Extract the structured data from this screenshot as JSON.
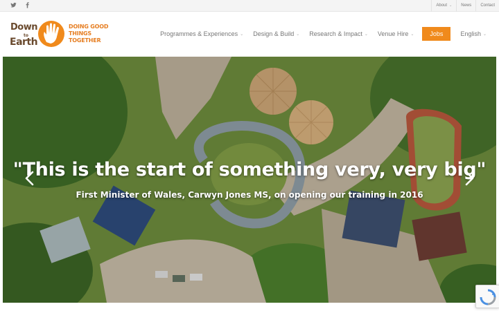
{
  "topbar": {
    "social": [
      {
        "icon": "twitter-icon",
        "glyph": "𝕏"
      },
      {
        "icon": "facebook-icon",
        "glyph": "f"
      }
    ],
    "links": [
      {
        "label": "About",
        "has_dropdown": true
      },
      {
        "label": "News",
        "has_dropdown": false
      },
      {
        "label": "Contact",
        "has_dropdown": false
      }
    ]
  },
  "logo": {
    "line1": "Down",
    "line2": "to",
    "line3": "Earth",
    "tagline": [
      "DOING GOOD",
      "THINGS",
      "TOGETHER"
    ],
    "colors": {
      "brown": "#6a4a2e",
      "orange": "#e67e22"
    }
  },
  "nav": {
    "items": [
      {
        "label": "Programmes & Experiences"
      },
      {
        "label": "Design & Build"
      },
      {
        "label": "Research & Impact"
      },
      {
        "label": "Venue Hire"
      }
    ],
    "jobs_label": "Jobs",
    "language": "English",
    "accent": "#f08a1c"
  },
  "hero": {
    "quote": "\"This is the start of something very, very big\"",
    "caption": "First Minister of Wales, Carwyn Jones MS, on opening our training in 2016",
    "prev_icon": "chevron-left-icon",
    "next_icon": "chevron-right-icon"
  },
  "recaptcha": {
    "icon": "recaptcha-icon"
  }
}
